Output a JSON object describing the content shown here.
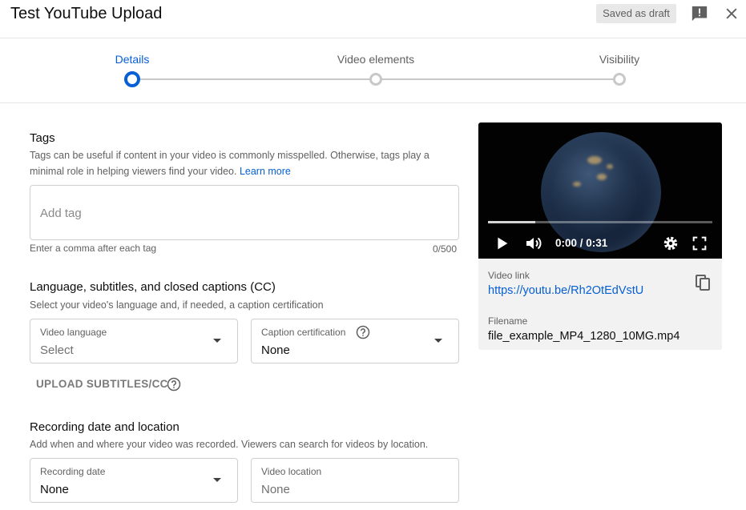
{
  "header": {
    "title": "Test YouTube Upload",
    "draft_badge": "Saved as draft",
    "feedback_icon": "feedback-icon",
    "close_icon": "close-icon"
  },
  "stepper": {
    "steps": [
      {
        "label": "Details",
        "active": true
      },
      {
        "label": "Video elements",
        "active": false
      },
      {
        "label": "Visibility",
        "active": false
      }
    ]
  },
  "tags": {
    "title": "Tags",
    "desc_text": "Tags can be useful if content in your video is commonly misspelled. Otherwise, tags play a minimal role in helping viewers find your video. ",
    "learn_more": "Learn more",
    "placeholder": "Add tag",
    "hint": "Enter a comma after each tag",
    "counter": "0/500"
  },
  "language": {
    "title": "Language, subtitles, and closed captions (CC)",
    "desc": "Select your video's language and, if needed, a caption certification",
    "video_language": {
      "label": "Video language",
      "value": "Select"
    },
    "caption_cert": {
      "label": "Caption certification",
      "value": "None"
    },
    "upload_subtitles": "UPLOAD SUBTITLES/CC"
  },
  "recording": {
    "title": "Recording date and location",
    "desc": "Add when and where your video was recorded. Viewers can search for videos by location.",
    "date": {
      "label": "Recording date",
      "value": "None"
    },
    "location": {
      "label": "Video location",
      "placeholder": "None"
    }
  },
  "preview": {
    "time": "0:00 / 0:31",
    "progress": 0.21,
    "video_link_label": "Video link",
    "video_link": "https://youtu.be/Rh2OtEdVstU",
    "filename_label": "Filename",
    "filename": "file_example_MP4_1280_10MG.mp4"
  },
  "colors": {
    "accent": "#065fd4",
    "muted_text": "#606060",
    "border": "#cfcfcf"
  }
}
